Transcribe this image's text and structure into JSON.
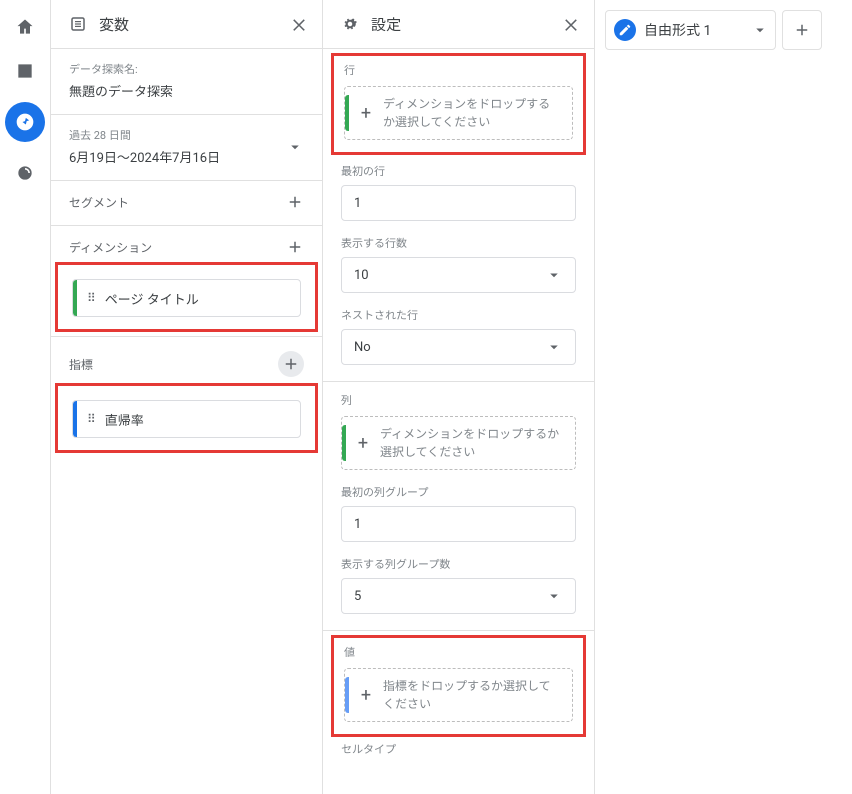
{
  "variables": {
    "title": "変数",
    "exploration_label": "データ探索名:",
    "exploration_name": "無題のデータ探索",
    "date_range_label": "過去 28 日間",
    "date_range_value": "6月19日～2024年7月16日",
    "segments_label": "セグメント",
    "dimensions_label": "ディメンション",
    "dimension_chip": "ページ タイトル",
    "metrics_label": "指標",
    "metric_chip": "直帰率"
  },
  "settings": {
    "title": "設定",
    "rows": {
      "label": "行",
      "drop_text": "ディメンションをドロップするか選択してください",
      "first_row_label": "最初の行",
      "first_row_value": "1",
      "show_rows_label": "表示する行数",
      "show_rows_value": "10",
      "nested_label": "ネストされた行",
      "nested_value": "No"
    },
    "cols": {
      "label": "列",
      "drop_text": "ディメンションをドロップするか選択してください",
      "first_col_label": "最初の列グループ",
      "first_col_value": "1",
      "show_cols_label": "表示する列グループ数",
      "show_cols_value": "5"
    },
    "values": {
      "label": "値",
      "drop_text": "指標をドロップするか選択してください",
      "celltype_label": "セルタイプ"
    }
  },
  "tabs": {
    "tab1_label": "自由形式 1"
  }
}
